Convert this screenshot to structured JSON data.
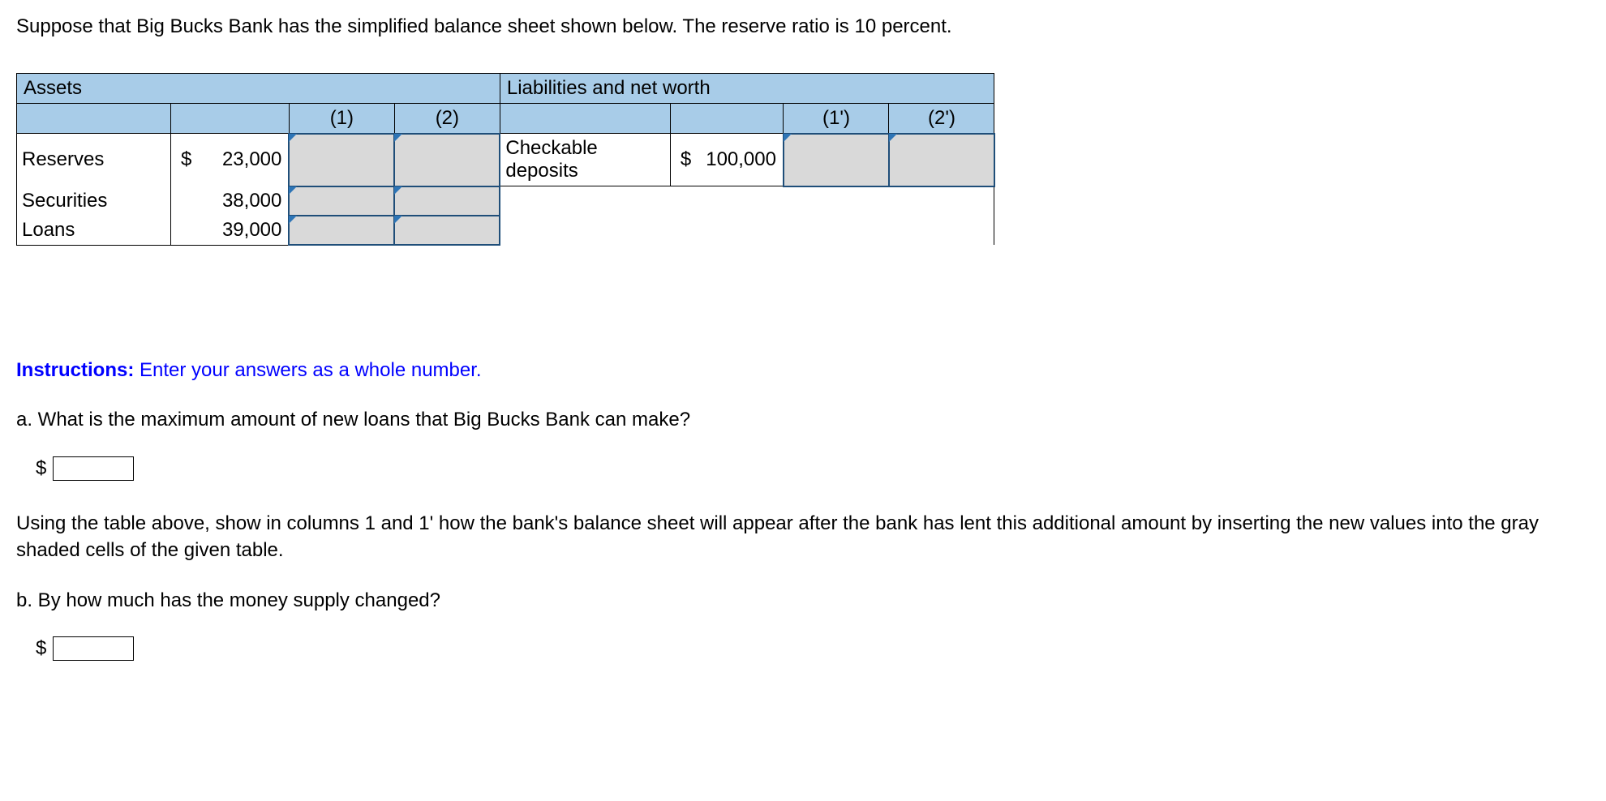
{
  "intro": "Suppose that Big Bucks Bank has the simplified balance sheet shown below. The reserve ratio is 10 percent.",
  "table": {
    "assets_header": "Assets",
    "liabilities_header": "Liabilities and net worth",
    "col1": "(1)",
    "col2": "(2)",
    "col1p": "(1')",
    "col2p": "(2')",
    "rows": {
      "reserves_label": "Reserves",
      "reserves_dollar": "$",
      "reserves_amount": "23,000",
      "securities_label": "Securities",
      "securities_amount": "38,000",
      "loans_label": "Loans",
      "loans_amount": "39,000",
      "checkable_label": "Checkable deposits",
      "checkable_dollar": "$",
      "checkable_amount": "100,000"
    }
  },
  "instructions_label": "Instructions:",
  "instructions_text": " Enter your answers as a whole number.",
  "question_a": "a. What is the maximum amount of new loans that Big Bucks Bank can make?",
  "followup_a": "Using the table above, show in columns 1 and 1' how the bank's balance sheet will appear after the bank has lent this additional amount by inserting the new values into the gray shaded cells of the given table.",
  "question_b": "b. By how much has the money supply changed?",
  "dollar": "$"
}
